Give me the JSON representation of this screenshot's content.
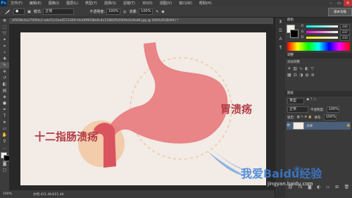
{
  "app": {
    "logo": "Ps"
  },
  "menu": {
    "items": [
      "文件(F)",
      "编辑(E)",
      "图像(I)",
      "图层(L)",
      "类型(Y)",
      "选择(S)",
      "滤镜(T)",
      "3D(D)",
      "视图(V)",
      "窗口(W)",
      "帮助(H)"
    ]
  },
  "options": {
    "mode_label": "模式:",
    "mode_value": "正常",
    "opacity_label": "不透明度:",
    "opacity_value": "100%",
    "flow_label": "流量:",
    "flow_value": "100%",
    "essentials": "基本功能"
  },
  "document": {
    "tab_title": "af5f38c6a1705fdc2-ade51c5ee6572309-fdc44f0038e0c4e11882f5456fde5c9a48.jpg @ 200%(RGB/8#) *",
    "status_zoom": "200%",
    "status_doc": "文档:421.4K/421.4K"
  },
  "artwork": {
    "label_stomach": "胃溃疡",
    "label_duodenum": "十二指肠溃疡",
    "colors": {
      "stomach": "#e8797c",
      "duodenum": "#d9545e",
      "circle": "#f2c7a0",
      "label": "#b23a43"
    }
  },
  "color_panel": {
    "tab": "颜色",
    "r": "242",
    "g": "237",
    "b": "233"
  },
  "adjust_panel": {
    "tab": "调整",
    "title": "添加调整"
  },
  "layers_panel": {
    "tab": "图层",
    "kind_label": "类型",
    "mode": "正常",
    "lock_label": "锁定:",
    "opacity_label": "不透明度:",
    "opacity": "100%",
    "fill_label": "填充:",
    "fill": "100%",
    "layer_name": "背景"
  },
  "watermark": {
    "text": "我爱Baidu经验",
    "url": "jingyan.baidu.com"
  }
}
